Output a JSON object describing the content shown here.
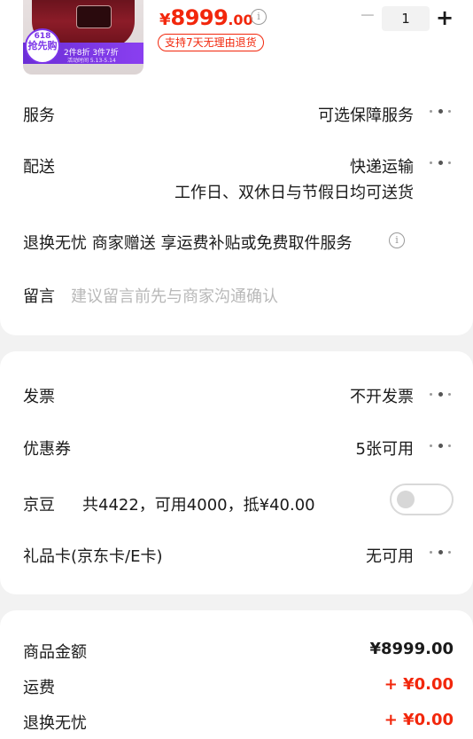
{
  "product": {
    "promo_badge_number": "618",
    "promo_badge_text": "抢先购",
    "promo_line": "2件8折 3件7折",
    "promo_date": "活动时间 5.13-5.14",
    "price_symbol": "¥",
    "price_integer": "8999",
    "price_decimal": ".00",
    "return_badge": "支持7天无理由退货",
    "quantity": "1",
    "minus_glyph": "−",
    "plus_glyph": "+",
    "info_glyph": "i"
  },
  "order_options": {
    "service_label": "服务",
    "service_value": "可选保障服务",
    "delivery_label": "配送",
    "delivery_value": "快递运输",
    "delivery_note": "工作日、双休日与节假日均可送货",
    "return_line": "退换无忧 商家赠送 享运费补贴或免费取件服务",
    "message_label": "留言",
    "message_placeholder": "建议留言前先与商家沟通确认"
  },
  "payment_options": {
    "invoice_label": "发票",
    "invoice_value": "不开发票",
    "coupon_label": "优惠券",
    "coupon_value": "5张可用",
    "jingdou_label": "京豆",
    "jingdou_value": "共4422，可用4000，抵¥40.00",
    "jingdou_toggle_on": false,
    "giftcard_label": "礼品卡(京东卡/E卡)",
    "giftcard_value": "无可用"
  },
  "summary": {
    "goods_label": "商品金额",
    "goods_amount": "¥8999.00",
    "shipping_label": "运费",
    "shipping_amount": "+ ¥0.00",
    "return_label": "退换无忧",
    "return_amount": "+ ¥0.00"
  },
  "colors": {
    "accent": "#f2270c",
    "promo_purple": "#7b35e8",
    "background": "#f2f2f2"
  },
  "icons": {
    "more": "more-dots-icon",
    "info": "info-icon",
    "toggle": "toggle-switch"
  }
}
